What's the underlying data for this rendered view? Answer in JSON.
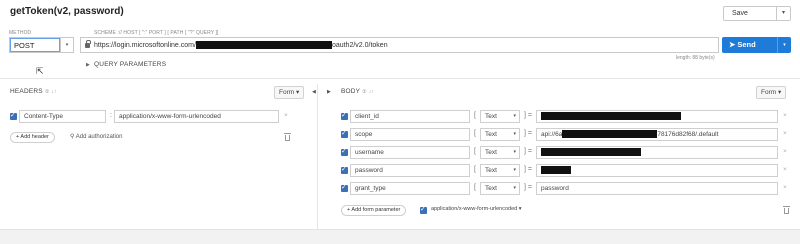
{
  "title": "getToken(v2, password)",
  "save": {
    "label": "Save",
    "caret": "▾"
  },
  "request": {
    "method_caption": "METHOD",
    "method": "POST",
    "url_caption": "SCHEME :// HOST [ \":\" PORT ] [ PATH [ \"?\" QUERY ]]",
    "url_prefix": "https://login.microsoftonline.com/",
    "url_suffix": "oauth2/v2.0/token",
    "send_label": "Send",
    "length_text": "length: 88 byte(s)",
    "query_params_label": "QUERY PARAMETERS"
  },
  "headers": {
    "label": "HEADERS",
    "count": "①",
    "sort_icon": "↓↑",
    "form_label": "Form ▾",
    "rows": [
      {
        "name": "Content-Type",
        "value": "application/x-www-form-urlencoded"
      }
    ],
    "add_label": "+ Add header",
    "auth_label": "Add authorization"
  },
  "body": {
    "label": "BODY",
    "count": "①",
    "sort_icon": "↓↑",
    "form_label": "Form ▾",
    "rows": [
      {
        "name": "client_id",
        "type": "Text",
        "value": ""
      },
      {
        "name": "scope",
        "type": "Text",
        "value_prefix": "api://6a",
        "value_suffix": "78176d82f68/.default"
      },
      {
        "name": "username",
        "type": "Text",
        "value": ""
      },
      {
        "name": "password",
        "type": "Text",
        "value": ""
      },
      {
        "name": "grant_type",
        "type": "Text",
        "value": "password"
      }
    ],
    "add_label": "+ Add form parameter",
    "content_type": "application/x-www-form-urlencoded ▾"
  },
  "glyphs": {
    "bracket_open": "[",
    "bracket_close": "] =",
    "pipe": ":",
    "close": "×",
    "arrow_left": "◀",
    "arrow_right": "▶",
    "caret": "▾",
    "tri": "▶"
  },
  "colors": {
    "accent": "#1f7bd8",
    "checkbox": "#3b6fb6"
  }
}
